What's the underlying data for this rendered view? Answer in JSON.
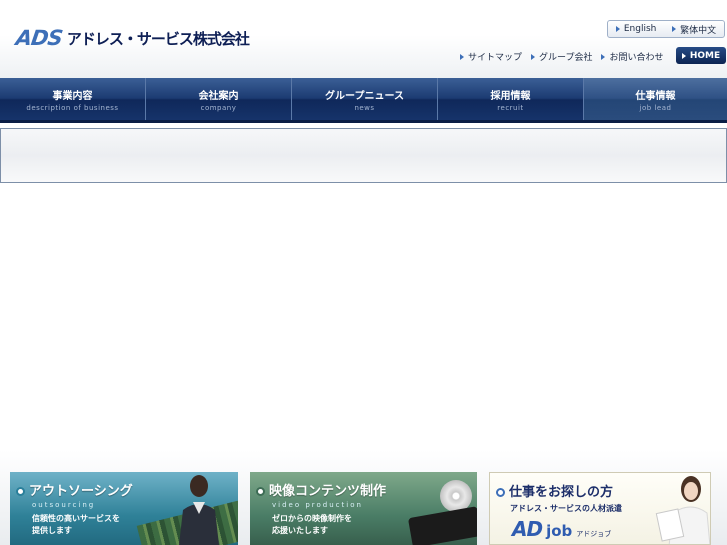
{
  "header": {
    "logo_mark": "ADS",
    "company_name": "アドレス・サービス株式会社",
    "languages": [
      "English",
      "繁体中文"
    ],
    "util_links": [
      "サイトマップ",
      "グループ会社",
      "お問い合わせ"
    ],
    "home_label": "HOME"
  },
  "nav": {
    "items": [
      {
        "label": "事業内容",
        "sub": "description of business"
      },
      {
        "label": "会社案内",
        "sub": "company"
      },
      {
        "label": "グループニュース",
        "sub": "news"
      },
      {
        "label": "採用情報",
        "sub": "recruit"
      },
      {
        "label": "仕事情報",
        "sub": "job lead"
      }
    ]
  },
  "banners": {
    "outsourcing": {
      "title": "アウトソーシング",
      "sub": "outsourcing",
      "desc_line1": "信頼性の高いサービスを",
      "desc_line2": "提供します"
    },
    "video": {
      "title": "映像コンテンツ制作",
      "sub": "video production",
      "desc_line1": "ゼロからの映像制作を",
      "desc_line2": "応援いたします"
    },
    "job": {
      "title": "仕事をお探しの方",
      "desc": "アドレス・サービスの人材派遣",
      "logo_ad": "AD",
      "logo_job": "job",
      "logo_kana": "アドジョブ"
    }
  },
  "colors": {
    "nav_dark": "#0f285a",
    "nav_light": "#3b5f96",
    "logo_blue": "#3d6fb8",
    "text_dark": "#0e1f55"
  }
}
